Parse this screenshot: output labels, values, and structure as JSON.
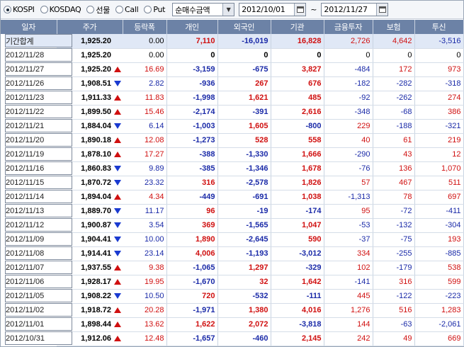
{
  "toolbar": {
    "radios": [
      {
        "label": "KOSPI",
        "selected": true
      },
      {
        "label": "KOSDAQ",
        "selected": false
      },
      {
        "label": "선물",
        "selected": false
      },
      {
        "label": "Call",
        "selected": false
      },
      {
        "label": "Put",
        "selected": false
      }
    ],
    "select_value": "순매수금액",
    "date_from": "2012/10/01",
    "date_separator": "~",
    "date_to": "2012/11/27"
  },
  "colors": {
    "header_bg": "#6c82a6",
    "up": "#d01010",
    "down": "#1a2aa8",
    "total_row_bg": "#e0e8f6"
  },
  "columns": [
    "일자",
    "주가",
    "등락폭",
    "개인",
    "외국인",
    "기관",
    "금융투자",
    "보험",
    "투신"
  ],
  "rows": [
    {
      "date": "기간합계",
      "price": "1,925.20",
      "dir": "",
      "change": "0.00",
      "indiv": "7,110",
      "foreign": "-16,019",
      "inst": "16,828",
      "fininv": "2,726",
      "insur": "4,642",
      "trust": "-3,516",
      "total": true
    },
    {
      "date": "2012/11/28",
      "price": "1,925.20",
      "dir": "",
      "change": "0.00",
      "indiv": "0",
      "foreign": "0",
      "inst": "0",
      "fininv": "0",
      "insur": "0",
      "trust": "0"
    },
    {
      "date": "2012/11/27",
      "price": "1,925.20",
      "dir": "up",
      "change": "16.69",
      "indiv": "-3,159",
      "foreign": "-675",
      "inst": "3,827",
      "fininv": "-484",
      "insur": "172",
      "trust": "973"
    },
    {
      "date": "2012/11/26",
      "price": "1,908.51",
      "dir": "dn",
      "change": "2.82",
      "indiv": "-936",
      "foreign": "267",
      "inst": "676",
      "fininv": "-182",
      "insur": "-282",
      "trust": "-318"
    },
    {
      "date": "2012/11/23",
      "price": "1,911.33",
      "dir": "up",
      "change": "11.83",
      "indiv": "-1,998",
      "foreign": "1,621",
      "inst": "485",
      "fininv": "-92",
      "insur": "-262",
      "trust": "274"
    },
    {
      "date": "2012/11/22",
      "price": "1,899.50",
      "dir": "up",
      "change": "15.46",
      "indiv": "-2,174",
      "foreign": "-391",
      "inst": "2,616",
      "fininv": "-348",
      "insur": "-68",
      "trust": "386"
    },
    {
      "date": "2012/11/21",
      "price": "1,884.04",
      "dir": "dn",
      "change": "6.14",
      "indiv": "-1,003",
      "foreign": "1,605",
      "inst": "-800",
      "fininv": "229",
      "insur": "-188",
      "trust": "-321"
    },
    {
      "date": "2012/11/20",
      "price": "1,890.18",
      "dir": "up",
      "change": "12.08",
      "indiv": "-1,273",
      "foreign": "528",
      "inst": "558",
      "fininv": "40",
      "insur": "61",
      "trust": "219"
    },
    {
      "date": "2012/11/19",
      "price": "1,878.10",
      "dir": "up",
      "change": "17.27",
      "indiv": "-388",
      "foreign": "-1,330",
      "inst": "1,666",
      "fininv": "-290",
      "insur": "43",
      "trust": "12"
    },
    {
      "date": "2012/11/16",
      "price": "1,860.83",
      "dir": "dn",
      "change": "9.89",
      "indiv": "-385",
      "foreign": "-1,346",
      "inst": "1,678",
      "fininv": "-76",
      "insur": "136",
      "trust": "1,070"
    },
    {
      "date": "2012/11/15",
      "price": "1,870.72",
      "dir": "dn",
      "change": "23.32",
      "indiv": "316",
      "foreign": "-2,578",
      "inst": "1,826",
      "fininv": "57",
      "insur": "467",
      "trust": "511"
    },
    {
      "date": "2012/11/14",
      "price": "1,894.04",
      "dir": "up",
      "change": "4.34",
      "indiv": "-449",
      "foreign": "-691",
      "inst": "1,038",
      "fininv": "-1,313",
      "insur": "78",
      "trust": "697"
    },
    {
      "date": "2012/11/13",
      "price": "1,889.70",
      "dir": "dn",
      "change": "11.17",
      "indiv": "96",
      "foreign": "-19",
      "inst": "-174",
      "fininv": "95",
      "insur": "-72",
      "trust": "-411"
    },
    {
      "date": "2012/11/12",
      "price": "1,900.87",
      "dir": "dn",
      "change": "3.54",
      "indiv": "369",
      "foreign": "-1,565",
      "inst": "1,047",
      "fininv": "-53",
      "insur": "-132",
      "trust": "-304"
    },
    {
      "date": "2012/11/09",
      "price": "1,904.41",
      "dir": "dn",
      "change": "10.00",
      "indiv": "1,890",
      "foreign": "-2,645",
      "inst": "590",
      "fininv": "-37",
      "insur": "-75",
      "trust": "193"
    },
    {
      "date": "2012/11/08",
      "price": "1,914.41",
      "dir": "dn",
      "change": "23.14",
      "indiv": "4,006",
      "foreign": "-1,193",
      "inst": "-3,012",
      "fininv": "334",
      "insur": "-255",
      "trust": "-885"
    },
    {
      "date": "2012/11/07",
      "price": "1,937.55",
      "dir": "up",
      "change": "9.38",
      "indiv": "-1,065",
      "foreign": "1,297",
      "inst": "-329",
      "fininv": "102",
      "insur": "-179",
      "trust": "538"
    },
    {
      "date": "2012/11/06",
      "price": "1,928.17",
      "dir": "up",
      "change": "19.95",
      "indiv": "-1,670",
      "foreign": "32",
      "inst": "1,642",
      "fininv": "-141",
      "insur": "316",
      "trust": "599"
    },
    {
      "date": "2012/11/05",
      "price": "1,908.22",
      "dir": "dn",
      "change": "10.50",
      "indiv": "720",
      "foreign": "-532",
      "inst": "-111",
      "fininv": "445",
      "insur": "-122",
      "trust": "-223"
    },
    {
      "date": "2012/11/02",
      "price": "1,918.72",
      "dir": "up",
      "change": "20.28",
      "indiv": "-1,971",
      "foreign": "1,380",
      "inst": "4,016",
      "fininv": "1,276",
      "insur": "516",
      "trust": "1,283"
    },
    {
      "date": "2012/11/01",
      "price": "1,898.44",
      "dir": "up",
      "change": "13.62",
      "indiv": "1,622",
      "foreign": "2,072",
      "inst": "-3,818",
      "fininv": "144",
      "insur": "-63",
      "trust": "-2,061"
    },
    {
      "date": "2012/10/31",
      "price": "1,912.06",
      "dir": "up",
      "change": "12.48",
      "indiv": "-1,657",
      "foreign": "-460",
      "inst": "2,145",
      "fininv": "242",
      "insur": "49",
      "trust": "669"
    }
  ]
}
